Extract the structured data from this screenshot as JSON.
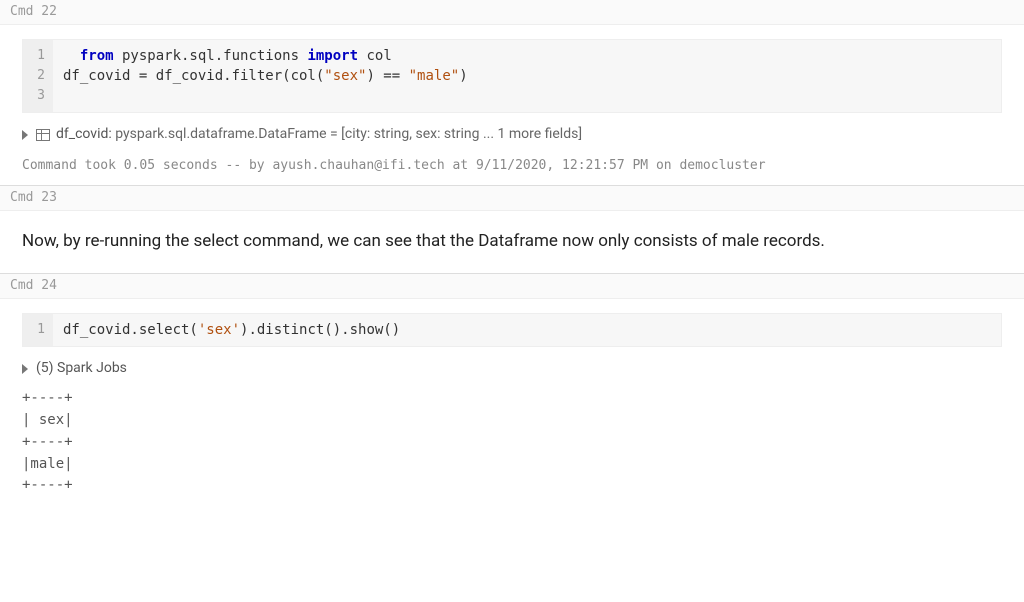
{
  "cmd22": {
    "header": "Cmd 22",
    "gutter": [
      "1",
      "2",
      "3"
    ],
    "code": {
      "l1": {
        "p1": "  ",
        "kw_from": "from",
        "p2": " pyspark.sql.functions ",
        "kw_import": "import",
        "p3": " col"
      },
      "l2": {
        "p1": "df_covid = df_covid.filter(col(",
        "s1": "\"sex\"",
        "p2": ") == ",
        "s2": "\"male\"",
        "p3": ")"
      },
      "l3": ""
    },
    "schema": {
      "df_name": "df_covid: ",
      "rest": "pyspark.sql.dataframe.DataFrame = [city: string, sex: string ... 1 more fields]"
    },
    "status": "Command took 0.05 seconds -- by ayush.chauhan@ifi.tech at 9/11/2020, 12:21:57 PM on democluster"
  },
  "cmd23": {
    "header": "Cmd 23",
    "markdown": "Now, by re-running the select command, we can see that the Dataframe now only consists of male records."
  },
  "cmd24": {
    "header": "Cmd 24",
    "gutter": [
      "1"
    ],
    "code": {
      "l1": {
        "p1": "df_covid.select(",
        "s1": "'sex'",
        "p2": ").distinct().show()"
      }
    },
    "spark_jobs": "(5) Spark Jobs",
    "ascii": "+----+\n| sex|\n+----+\n|male|\n+----+"
  }
}
